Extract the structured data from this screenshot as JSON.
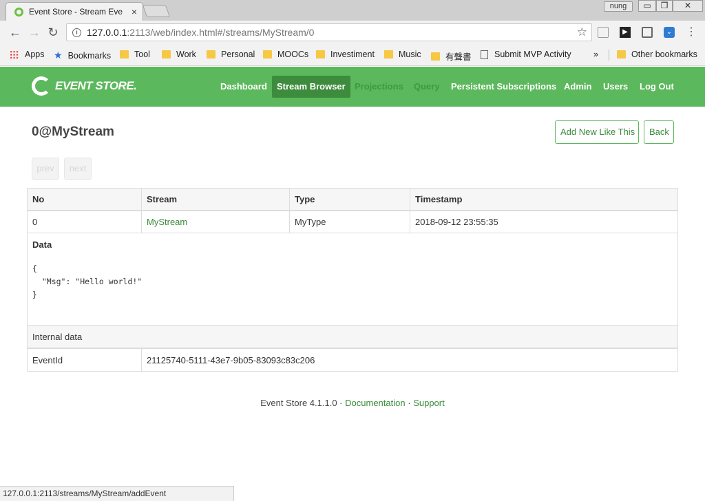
{
  "browser": {
    "tab_title": "Event Store - Stream Eve",
    "profile": "nung",
    "url_host": "127.0.0.1",
    "url_rest": ":2113/web/index.html#/streams/MyStream/0",
    "status_url": "127.0.0.1:2113/streams/MyStream/addEvent",
    "window_buttons": {
      "minimize": "▭",
      "maximize": "❐",
      "close": "✕"
    },
    "bookmarks": [
      {
        "label": "Apps",
        "icon": "apps-grid-icon"
      },
      {
        "label": "Bookmarks",
        "icon": "star-icon"
      },
      {
        "label": "Tool",
        "icon": "folder-icon"
      },
      {
        "label": "Work",
        "icon": "folder-icon"
      },
      {
        "label": "Personal",
        "icon": "folder-icon"
      },
      {
        "label": "MOOCs",
        "icon": "folder-icon"
      },
      {
        "label": "Investiment",
        "icon": "folder-icon"
      },
      {
        "label": "Music",
        "icon": "folder-icon"
      },
      {
        "label": "有聲書",
        "icon": "folder-icon"
      },
      {
        "label": "Submit MVP Activity",
        "icon": "page-icon"
      }
    ],
    "overflow": "»",
    "other_bookmarks": "Other bookmarks"
  },
  "app": {
    "logo_text": "EVENT STORE.",
    "nav": [
      {
        "label": "Dashboard",
        "state": "normal"
      },
      {
        "label": "Stream Browser",
        "state": "active"
      },
      {
        "label": "Projections",
        "state": "muted"
      },
      {
        "label": "Query",
        "state": "muted"
      },
      {
        "label": "Persistent Subscriptions",
        "state": "normal"
      },
      {
        "label": "Admin",
        "state": "normal"
      },
      {
        "label": "Users",
        "state": "normal"
      },
      {
        "label": "Log Out",
        "state": "normal"
      }
    ],
    "brand_color": "#5cb85c"
  },
  "page": {
    "title": "0@MyStream",
    "add_new_label": "Add New Like This",
    "back_label": "Back",
    "prev_label": "prev",
    "next_label": "next"
  },
  "event": {
    "headers": [
      "No",
      "Stream",
      "Type",
      "Timestamp"
    ],
    "row": {
      "no": "0",
      "stream": "MyStream",
      "type": "MyType",
      "timestamp": "2018-09-12 23:55:35"
    },
    "data_label": "Data",
    "data_json": "{\n  \"Msg\": \"Hello world!\"\n}",
    "internal_label": "Internal data",
    "internal_key": "EventId",
    "internal_value": "21125740-5111-43e7-9b05-83093c83c206"
  },
  "footer": {
    "version": "Event Store 4.1.1.0",
    "sep": "·",
    "documentation": "Documentation",
    "support": "Support"
  }
}
